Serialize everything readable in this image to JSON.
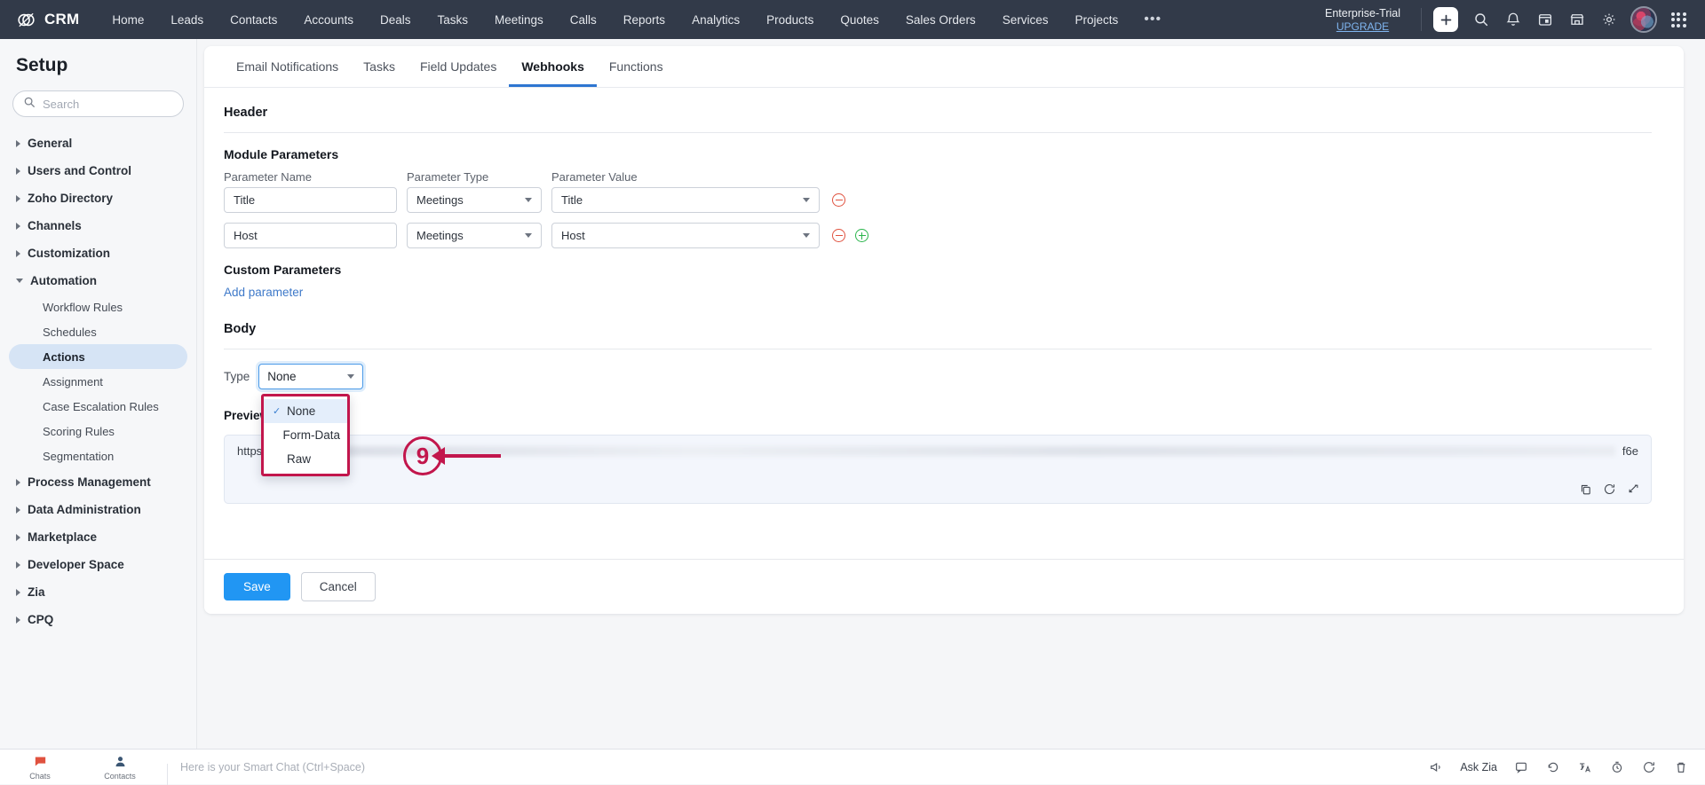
{
  "topnav": {
    "brand": "CRM",
    "brand_icon": "zoho-crm-logo-icon",
    "links": [
      "Home",
      "Leads",
      "Contacts",
      "Accounts",
      "Deals",
      "Tasks",
      "Meetings",
      "Calls",
      "Reports",
      "Analytics",
      "Products",
      "Quotes",
      "Sales Orders",
      "Services",
      "Projects"
    ],
    "more": "•••",
    "trial_label": "Enterprise-Trial",
    "upgrade_label": "UPGRADE",
    "icons": [
      "plus-icon",
      "search-icon",
      "bell-icon",
      "calendar-icon",
      "store-icon",
      "gear-icon",
      "avatar",
      "app-grid-icon"
    ]
  },
  "sidebar": {
    "title": "Setup",
    "search_placeholder": "Search",
    "search_value": "",
    "groups": [
      {
        "label": "General",
        "expanded": false
      },
      {
        "label": "Users and Control",
        "expanded": false
      },
      {
        "label": "Zoho Directory",
        "expanded": false
      },
      {
        "label": "Channels",
        "expanded": false
      },
      {
        "label": "Customization",
        "expanded": false
      },
      {
        "label": "Automation",
        "expanded": true
      },
      {
        "label": "Process Management",
        "expanded": false
      },
      {
        "label": "Data Administration",
        "expanded": false
      },
      {
        "label": "Marketplace",
        "expanded": false
      },
      {
        "label": "Developer Space",
        "expanded": false
      },
      {
        "label": "Zia",
        "expanded": false
      },
      {
        "label": "CPQ",
        "expanded": false
      }
    ],
    "automation_items": [
      {
        "label": "Workflow Rules",
        "active": false
      },
      {
        "label": "Schedules",
        "active": false
      },
      {
        "label": "Actions",
        "active": true
      },
      {
        "label": "Assignment",
        "active": false
      },
      {
        "label": "Case Escalation Rules",
        "active": false
      },
      {
        "label": "Scoring Rules",
        "active": false
      },
      {
        "label": "Segmentation",
        "active": false
      }
    ]
  },
  "main": {
    "tabs": [
      {
        "label": "Email Notifications",
        "active": false
      },
      {
        "label": "Tasks",
        "active": false
      },
      {
        "label": "Field Updates",
        "active": false
      },
      {
        "label": "Webhooks",
        "active": true
      },
      {
        "label": "Functions",
        "active": false
      }
    ],
    "header_section_title": "Header",
    "module_params_title": "Module Parameters",
    "param_columns": [
      "Parameter Name",
      "Parameter Type",
      "Parameter Value"
    ],
    "param_rows": [
      {
        "name": "Title",
        "type": "Meetings",
        "value": "Title",
        "has_add": false
      },
      {
        "name": "Host",
        "type": "Meetings",
        "value": "Host",
        "has_add": true
      }
    ],
    "custom_params_title": "Custom Parameters",
    "add_parameter_link": "Add parameter",
    "body_title": "Body",
    "type_label": "Type",
    "type_value": "None",
    "type_options": [
      {
        "label": "None",
        "selected": true
      },
      {
        "label": "Form-Data",
        "selected": false
      },
      {
        "label": "Raw",
        "selected": false
      }
    ],
    "preview_label": "Preview URL",
    "preview_url_start": "https://s86",
    "preview_url_end": "f6e",
    "preview_tools": [
      "copy-icon",
      "refresh-icon",
      "expand-icon"
    ],
    "save_label": "Save",
    "cancel_label": "Cancel"
  },
  "annotation": {
    "step_number": "9"
  },
  "taskbar": {
    "chips": [
      {
        "label": "Chats",
        "icon": "chat-icon"
      },
      {
        "label": "Contacts",
        "icon": "contacts-icon"
      }
    ],
    "smart_chat_placeholder": "Here is your Smart Chat (Ctrl+Space)",
    "ask_zia_label": "Ask Zia",
    "icons": [
      "announcement-icon",
      "feedback-icon",
      "undo-icon",
      "translate-icon",
      "timer-icon",
      "refresh-icon",
      "trash-icon"
    ]
  },
  "colors": {
    "nav_bg": "#323a49",
    "accent_blue": "#2196f3",
    "annotation_crimson": "#c2164c",
    "active_item_bg": "#d6e4f5",
    "minus_red": "#e0523f",
    "plus_green": "#2ab54b"
  }
}
